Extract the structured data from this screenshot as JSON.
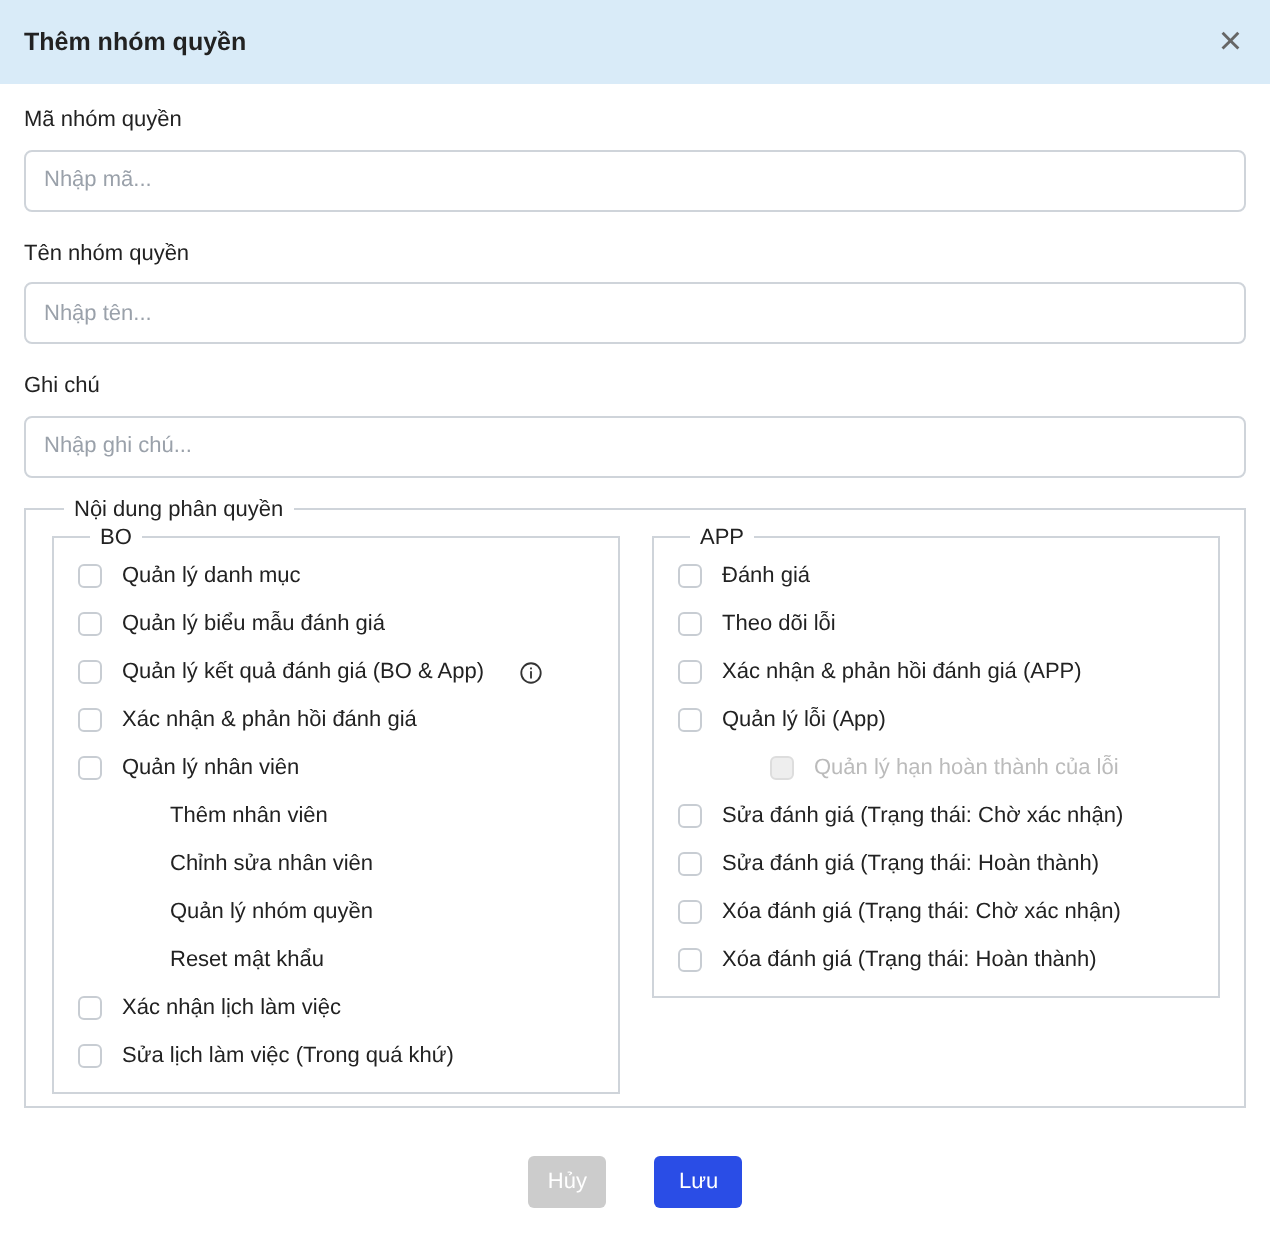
{
  "dialog": {
    "title": "Thêm nhóm quyền",
    "close": "×"
  },
  "fields": [
    {
      "label": "Mã nhóm quyền",
      "placeholder": "Nhập mã..."
    },
    {
      "label": "Tên nhóm quyền",
      "placeholder": "Nhập tên..."
    },
    {
      "label": "Ghi chú",
      "placeholder": "Nhập ghi chú..."
    }
  ],
  "permissions": {
    "legend": "Nội dung phân quyền",
    "groups": [
      {
        "legend": "BO",
        "items": [
          {
            "kind": "checkbox",
            "label": "Quản lý danh mục",
            "checked": false,
            "disabled": false,
            "info": false
          },
          {
            "kind": "checkbox",
            "label": "Quản lý biểu mẫu đánh giá",
            "checked": false,
            "disabled": false,
            "info": false
          },
          {
            "kind": "checkbox",
            "label": "Quản lý kết quả đánh giá (BO & App)",
            "checked": false,
            "disabled": false,
            "info": true
          },
          {
            "kind": "checkbox",
            "label": "Xác nhận & phản hồi đánh giá",
            "checked": false,
            "disabled": false,
            "info": false
          },
          {
            "kind": "checkbox",
            "label": "Quản lý nhân viên",
            "checked": false,
            "disabled": false,
            "info": false,
            "children": [
              {
                "kind": "text",
                "label": "Thêm nhân viên"
              },
              {
                "kind": "text",
                "label": "Chỉnh sửa nhân viên"
              },
              {
                "kind": "text",
                "label": "Quản lý nhóm quyền"
              },
              {
                "kind": "text",
                "label": "Reset mật khẩu"
              }
            ]
          },
          {
            "kind": "checkbox",
            "label": "Xác nhận lịch làm việc",
            "checked": false,
            "disabled": false,
            "info": false
          },
          {
            "kind": "checkbox",
            "label": "Sửa lịch làm việc (Trong quá khứ)",
            "checked": false,
            "disabled": false,
            "info": false
          }
        ]
      },
      {
        "legend": "APP",
        "items": [
          {
            "kind": "checkbox",
            "label": "Đánh giá",
            "checked": false,
            "disabled": false,
            "info": false
          },
          {
            "kind": "checkbox",
            "label": "Theo dõi lỗi",
            "checked": false,
            "disabled": false,
            "info": false
          },
          {
            "kind": "checkbox",
            "label": "Xác nhận & phản hồi đánh giá (APP)",
            "checked": false,
            "disabled": false,
            "info": false
          },
          {
            "kind": "checkbox",
            "label": "Quản lý lỗi (App)",
            "checked": false,
            "disabled": false,
            "info": false,
            "children": [
              {
                "kind": "checkbox",
                "label": "Quản lý hạn hoàn thành của lỗi",
                "checked": false,
                "disabled": true,
                "info": false
              }
            ]
          },
          {
            "kind": "checkbox",
            "label": "Sửa đánh giá (Trạng thái: Chờ xác nhận)",
            "checked": false,
            "disabled": false,
            "info": false
          },
          {
            "kind": "checkbox",
            "label": "Sửa đánh giá (Trạng thái: Hoàn thành)",
            "checked": false,
            "disabled": false,
            "info": false
          },
          {
            "kind": "checkbox",
            "label": "Xóa đánh giá (Trạng thái: Chờ xác nhận)",
            "checked": false,
            "disabled": false,
            "info": false
          },
          {
            "kind": "checkbox",
            "label": "Xóa đánh giá (Trạng thái: Hoàn thành)",
            "checked": false,
            "disabled": false,
            "info": false
          }
        ]
      }
    ]
  },
  "buttons": [
    {
      "label": "Hủy",
      "disabled": true
    },
    {
      "label": "Lưu",
      "disabled": false
    }
  ]
}
